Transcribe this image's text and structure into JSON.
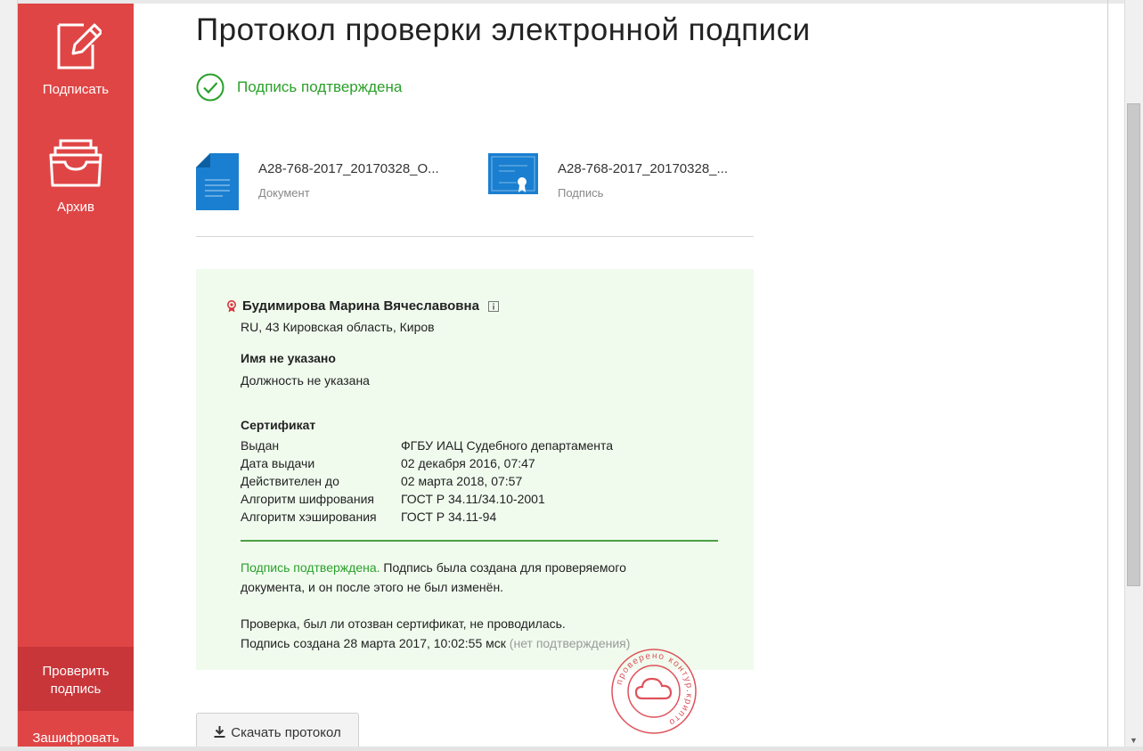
{
  "sidebar": {
    "sign_label": "Подписать",
    "archive_label": "Архив",
    "verify_label_line1": "Проверить",
    "verify_label_line2": "подпись",
    "encrypt_label": "Зашифровать"
  },
  "page": {
    "title": "Протокол проверки электронной подписи",
    "status": "Подпись подтверждена"
  },
  "files": {
    "document": {
      "name": "A28-768-2017_20170328_O...",
      "type": "Документ",
      "icon": "document-icon"
    },
    "signature": {
      "name": "A28-768-2017_20170328_...",
      "type": "Подпись",
      "icon": "certificate-icon"
    }
  },
  "signer": {
    "name": "Будимирова Марина Вячеславовна",
    "location": "RU, 43 Кировская область, Киров",
    "holder_name": "Имя не указано",
    "position": "Должность не указана"
  },
  "certificate": {
    "heading": "Сертификат",
    "rows": [
      {
        "key": "Выдан",
        "value": "ФГБУ ИАЦ Судебного департамента"
      },
      {
        "key": "Дата выдачи",
        "value": "02 декабря 2016, 07:47"
      },
      {
        "key": "Действителен до",
        "value": "02 марта 2018, 07:57"
      },
      {
        "key": "Алгоритм шифрования",
        "value": "ГОСТ Р 34.11/34.10-2001"
      },
      {
        "key": "Алгоритм хэширования",
        "value": "ГОСТ Р 34.11-94"
      }
    ]
  },
  "result": {
    "confirmed": "Подпись подтверждена.",
    "confirmed_detail": " Подпись была создана для проверяемого документа, и он после этого не был изменён.",
    "revocation": "Проверка, был ли отозван сертификат, не проводилась.",
    "created": "Подпись создана 28 марта 2017, 10:02:55 мск",
    "created_note": " (нет подтверждения)"
  },
  "actions": {
    "download_label": "Скачать протокол"
  },
  "stamp": {
    "text": "проверено контур.крипто"
  },
  "colors": {
    "sidebar": "#e04545",
    "sidebar_active": "#c8363a",
    "success": "#2aa02a",
    "panel_bg": "#f0fbee",
    "file_icon": "#1a7fd0",
    "stamp": "#d9343e"
  }
}
